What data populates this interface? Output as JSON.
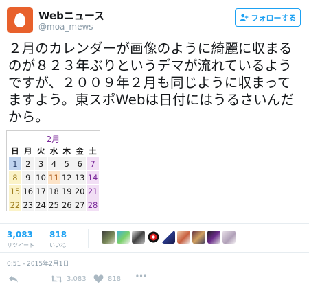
{
  "account": {
    "name": "Webニュース",
    "handle": "@moa_mews",
    "avatar_icon": "egg-avatar-icon"
  },
  "follow_button": {
    "label": "フォローする",
    "icon": "add-user-icon"
  },
  "tweet": {
    "text": "２月のカレンダーが画像のように綺麗に収まるのが８２３年ぶりというデマが流れているようですが、２００９年２月も同じように収まってますよう。東スポWebは日付にはうるさいんだから。"
  },
  "calendar": {
    "title": "2月",
    "weekdays": [
      "日",
      "月",
      "火",
      "水",
      "木",
      "金",
      "土"
    ],
    "weeks": [
      [
        "1",
        "2",
        "3",
        "4",
        "5",
        "6",
        "7"
      ],
      [
        "8",
        "9",
        "10",
        "11",
        "12",
        "13",
        "14"
      ],
      [
        "15",
        "16",
        "17",
        "18",
        "19",
        "20",
        "21"
      ],
      [
        "22",
        "23",
        "24",
        "25",
        "26",
        "27",
        "28"
      ]
    ]
  },
  "stats": {
    "retweets": {
      "count": "3,083",
      "label": "リツイート"
    },
    "likes": {
      "count": "818",
      "label": "いいね"
    }
  },
  "timestamp": "0:51 - 2015年2月1日",
  "actions": {
    "retweet_count": "3,083",
    "like_count": "818"
  },
  "colors": {
    "accent": "#1da1f2",
    "avatar_bg": "#e8612c",
    "muted": "#8899a6"
  }
}
